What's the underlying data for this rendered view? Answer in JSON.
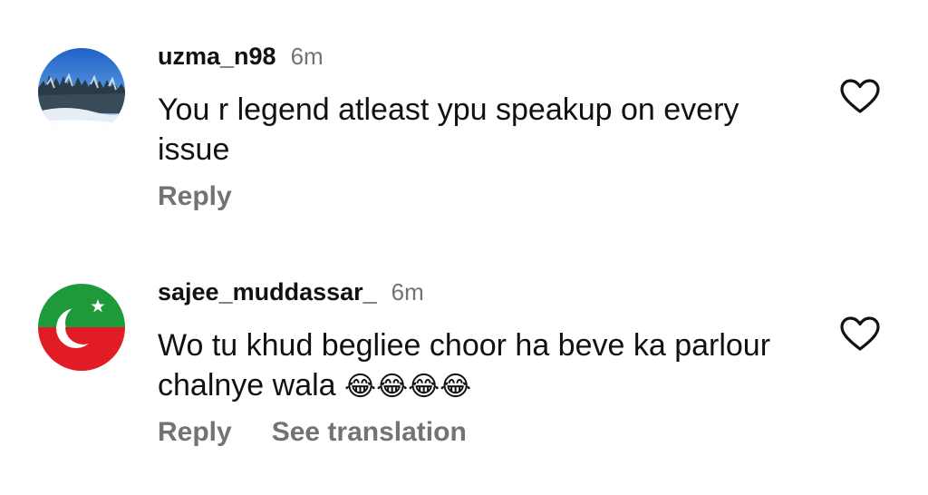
{
  "comments": [
    {
      "username": "uzma_n98",
      "time": "6m",
      "text": "You r legend atleast ypu speakup on every issue",
      "emoji": "",
      "actions": [
        "Reply"
      ],
      "avatar_icon": "snowy-forest-photo",
      "like_icon": "heart-outline-icon"
    },
    {
      "username": "sajee_muddassar_",
      "time": "6m",
      "text": "Wo tu khud begliee choor ha beve ka parlour chalnye wala ",
      "emoji": "😂😂😂😂",
      "actions": [
        "Reply",
        "See translation"
      ],
      "avatar_icon": "crescent-star-flag-logo",
      "like_icon": "heart-outline-icon"
    }
  ],
  "colors": {
    "text": "#111111",
    "secondary": "#737373",
    "flag_green": "#1f9a3a",
    "flag_red": "#e21c24"
  }
}
